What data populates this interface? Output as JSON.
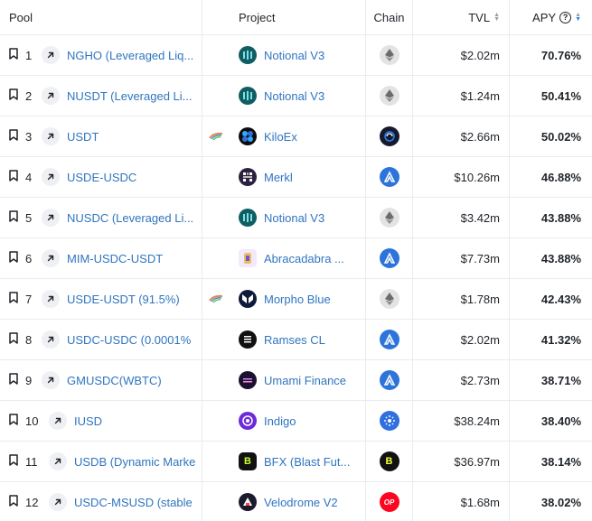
{
  "header": {
    "pool": "Pool",
    "project": "Project",
    "chain": "Chain",
    "tvl": "TVL",
    "apy": "APY",
    "help_icon": "?"
  },
  "rows": [
    {
      "rank": "1",
      "pool": "NGHO (Leveraged Liq...",
      "project": "Notional V3",
      "project_icon": "notional-icon",
      "chain": "ethereum",
      "tvl": "$2.02m",
      "apy": "70.76%",
      "flag": false
    },
    {
      "rank": "2",
      "pool": "NUSDT (Leveraged Li...",
      "project": "Notional V3",
      "project_icon": "notional-icon",
      "chain": "ethereum",
      "tvl": "$1.24m",
      "apy": "50.41%",
      "flag": false
    },
    {
      "rank": "3",
      "pool": "USDT",
      "project": "KiloEx",
      "project_icon": "kiloex-icon",
      "chain": "other",
      "tvl": "$2.66m",
      "apy": "50.02%",
      "flag": true
    },
    {
      "rank": "4",
      "pool": "USDE-USDC",
      "project": "Merkl",
      "project_icon": "merkl-icon",
      "chain": "arbitrum",
      "tvl": "$10.26m",
      "apy": "46.88%",
      "flag": false
    },
    {
      "rank": "5",
      "pool": "NUSDC (Leveraged Li...",
      "project": "Notional V3",
      "project_icon": "notional-icon",
      "chain": "ethereum",
      "tvl": "$3.42m",
      "apy": "43.88%",
      "flag": false
    },
    {
      "rank": "6",
      "pool": "MIM-USDC-USDT",
      "project": "Abracadabra ...",
      "project_icon": "abracadabra-icon",
      "chain": "arbitrum",
      "tvl": "$7.73m",
      "apy": "43.88%",
      "flag": false
    },
    {
      "rank": "7",
      "pool": "USDE-USDT (91.5%)",
      "project": "Morpho Blue",
      "project_icon": "morpho-icon",
      "chain": "ethereum",
      "tvl": "$1.78m",
      "apy": "42.43%",
      "flag": true
    },
    {
      "rank": "8",
      "pool": "USDC-USDC (0.0001%",
      "project": "Ramses CL",
      "project_icon": "ramses-icon",
      "chain": "arbitrum",
      "tvl": "$2.02m",
      "apy": "41.32%",
      "flag": false
    },
    {
      "rank": "9",
      "pool": "GMUSDC(WBTC)",
      "project": "Umami Finance",
      "project_icon": "umami-icon",
      "chain": "arbitrum",
      "tvl": "$2.73m",
      "apy": "38.71%",
      "flag": false
    },
    {
      "rank": "10",
      "pool": "IUSD",
      "project": "Indigo",
      "project_icon": "indigo-icon",
      "chain": "cardano",
      "tvl": "$38.24m",
      "apy": "38.40%",
      "flag": false
    },
    {
      "rank": "11",
      "pool": "USDB (Dynamic Marke",
      "project": "BFX (Blast Fut...",
      "project_icon": "bfx-icon",
      "chain": "blast",
      "tvl": "$36.97m",
      "apy": "38.14%",
      "flag": false
    },
    {
      "rank": "12",
      "pool": "USDC-MSUSD (stable",
      "project": "Velodrome V2",
      "project_icon": "velodrome-icon",
      "chain": "optimism",
      "tvl": "$1.68m",
      "apy": "38.02%",
      "flag": false
    }
  ],
  "colors": {
    "link": "#2f75c0",
    "arbitrum": "#2d74da",
    "optimism": "#ff0420",
    "ethereum_bg": "#e5e5e5"
  }
}
